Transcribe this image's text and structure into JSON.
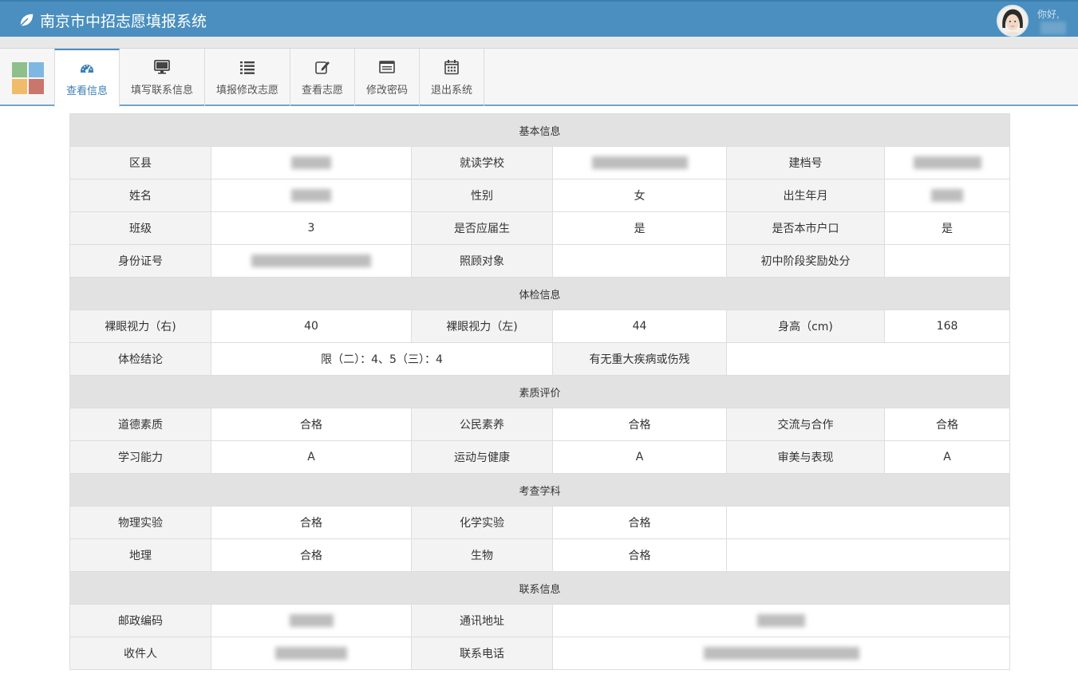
{
  "header": {
    "title": "南京市中招志愿填报系统",
    "greeting": "你好,"
  },
  "nav": {
    "tabs": [
      {
        "label": "查看信息",
        "icon": "dashboard-icon"
      },
      {
        "label": "填写联系信息",
        "icon": "monitor-icon"
      },
      {
        "label": "填报修改志愿",
        "icon": "list-icon"
      },
      {
        "label": "查看志愿",
        "icon": "edit-icon"
      },
      {
        "label": "修改密码",
        "icon": "window-icon"
      },
      {
        "label": "退出系统",
        "icon": "calendar-icon"
      }
    ],
    "active_tab": "查看信息"
  },
  "colors": {
    "header": "#4a8fbf",
    "active_tab": "#3d7fb3",
    "section_bg": "#e2e2e2",
    "label_bg": "#f3f3f3"
  },
  "sections": {
    "basic": {
      "title": "基本信息",
      "district_label": "区县",
      "school_label": "就读学校",
      "file_no_label": "建档号",
      "name_label": "姓名",
      "gender_label": "性别",
      "gender": "女",
      "birth_label": "出生年月",
      "class_label": "班级",
      "class": "3",
      "current_grad_label": "是否应届生",
      "current_grad": "是",
      "local_hukou_label": "是否本市户口",
      "local_hukou": "是",
      "id_label": "身份证号",
      "care_label": "照顾对象",
      "care": "",
      "award_label": "初中阶段奖励处分",
      "award": ""
    },
    "physical": {
      "title": "体检信息",
      "vision_right_label": "裸眼视力（右)",
      "vision_right": "40",
      "vision_left_label": "裸眼视力（左)",
      "vision_left": "44",
      "height_label": "身高（cm)",
      "height": "168",
      "conclusion_label": "体检结论",
      "conclusion": "限（二）：4、5（三）：4",
      "disease_label": "有无重大疾病或伤残",
      "disease": ""
    },
    "quality": {
      "title": "素质评价",
      "moral_label": "道德素质",
      "moral": "合格",
      "civic_label": "公民素养",
      "civic": "合格",
      "communication_label": "交流与合作",
      "communication": "合格",
      "learning_label": "学习能力",
      "learning": "A",
      "sports_label": "运动与健康",
      "sports": "A",
      "aesthetic_label": "审美与表现",
      "aesthetic": "A"
    },
    "subjects": {
      "title": "考查学科",
      "physics_lab_label": "物理实验",
      "physics_lab": "合格",
      "chem_lab_label": "化学实验",
      "chem_lab": "合格",
      "geography_label": "地理",
      "geography": "合格",
      "biology_label": "生物",
      "biology": "合格"
    },
    "contact": {
      "title": "联系信息",
      "postcode_label": "邮政编码",
      "address_label": "通讯地址",
      "recipient_label": "收件人",
      "phone_label": "联系电话"
    }
  }
}
